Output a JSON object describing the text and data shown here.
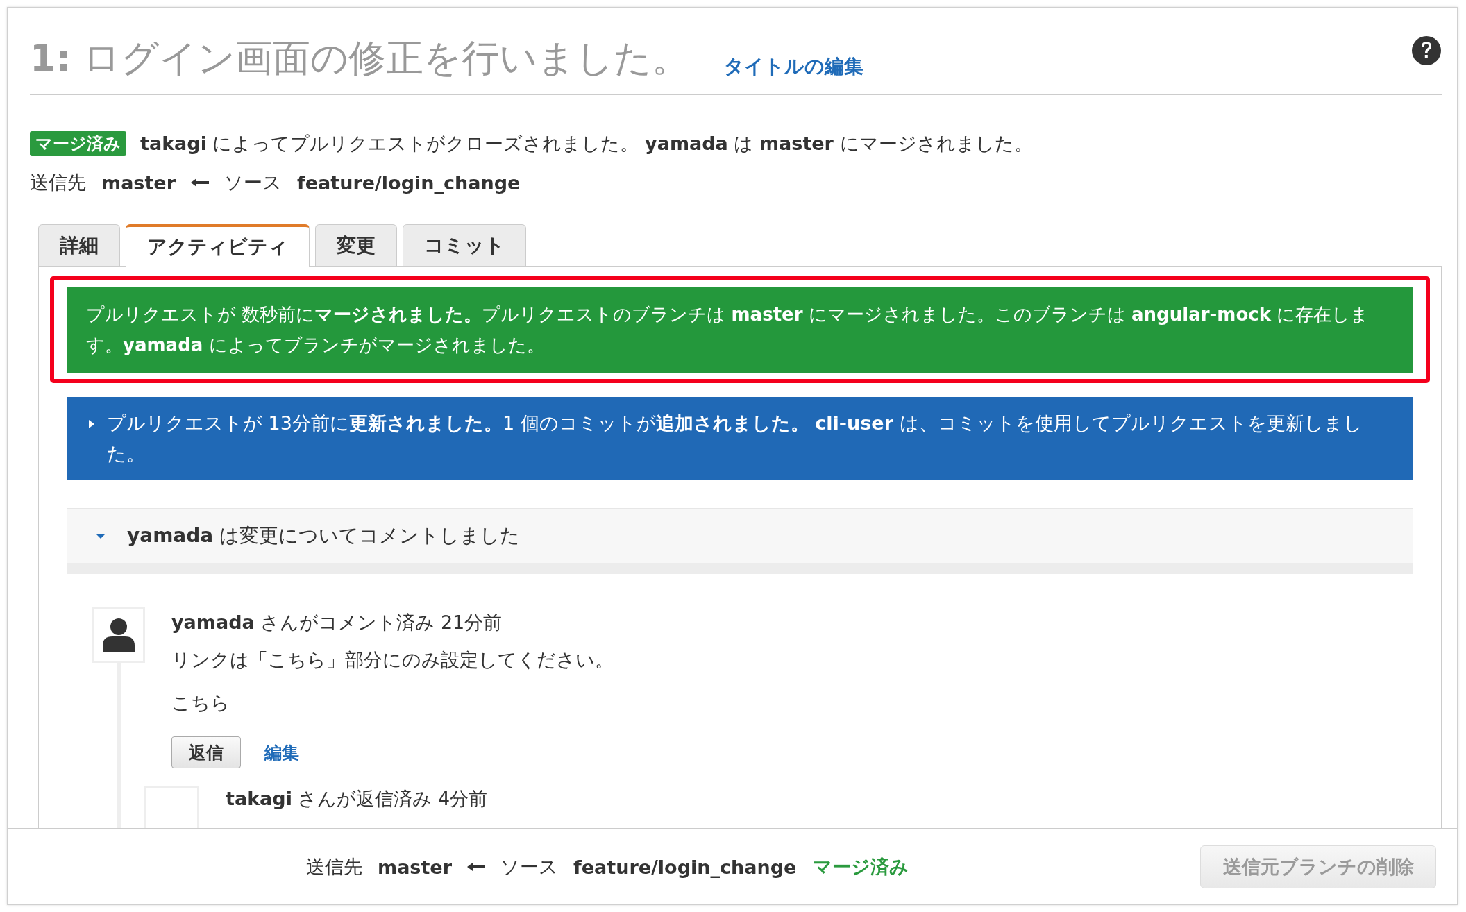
{
  "title": {
    "number": "1:",
    "text": "ログイン画面の修正を行いました。",
    "edit_link": "タイトルの編集"
  },
  "status": {
    "badge": "マージ済み",
    "message": "**takagi** によってプルリクエストがクローズされました。 **yamada** は **master** にマージされました。"
  },
  "branches": {
    "target_label": "送信先",
    "target": "master",
    "source_label": "ソース",
    "source": "feature/login_change"
  },
  "tabs": [
    {
      "label": "詳細",
      "selected": false
    },
    {
      "label": "アクティビティ",
      "selected": true
    },
    {
      "label": "変更",
      "selected": false
    },
    {
      "label": "コミット",
      "selected": false
    }
  ],
  "merge_event": {
    "highlighted": true,
    "text": "プルリクエストが 数秒前に**マージされました。**プルリクエストのブランチは **master** にマージされました。このブランチは **angular-mock** に存在します。**yamada** によってブランチがマージされました。"
  },
  "update_event": {
    "expanded": false,
    "text": "プルリクエストが 13分前に**更新されました。**1 個のコミットが**追加されました。** **cli-user** は、コミットを使用してプルリクエストを更新しました。"
  },
  "comment_thread": {
    "expanded": true,
    "header": "**yamada** は変更についてコメントしました",
    "comment": {
      "author": "yamada",
      "meta": "さんがコメント済み 21分前",
      "body": "リンクは「こちら」部分にのみ設定してください。",
      "body_2": "こちら",
      "reply_button": "返信",
      "edit_link": "編集"
    },
    "reply": {
      "author": "takagi",
      "meta": "さんが返信済み 4分前"
    }
  },
  "footer": {
    "target_label": "送信先",
    "target": "master",
    "source_label": "ソース",
    "source": "feature/login_change",
    "status": "マージ済み",
    "delete_button": "送信元ブランチの削除",
    "delete_disabled": true
  }
}
